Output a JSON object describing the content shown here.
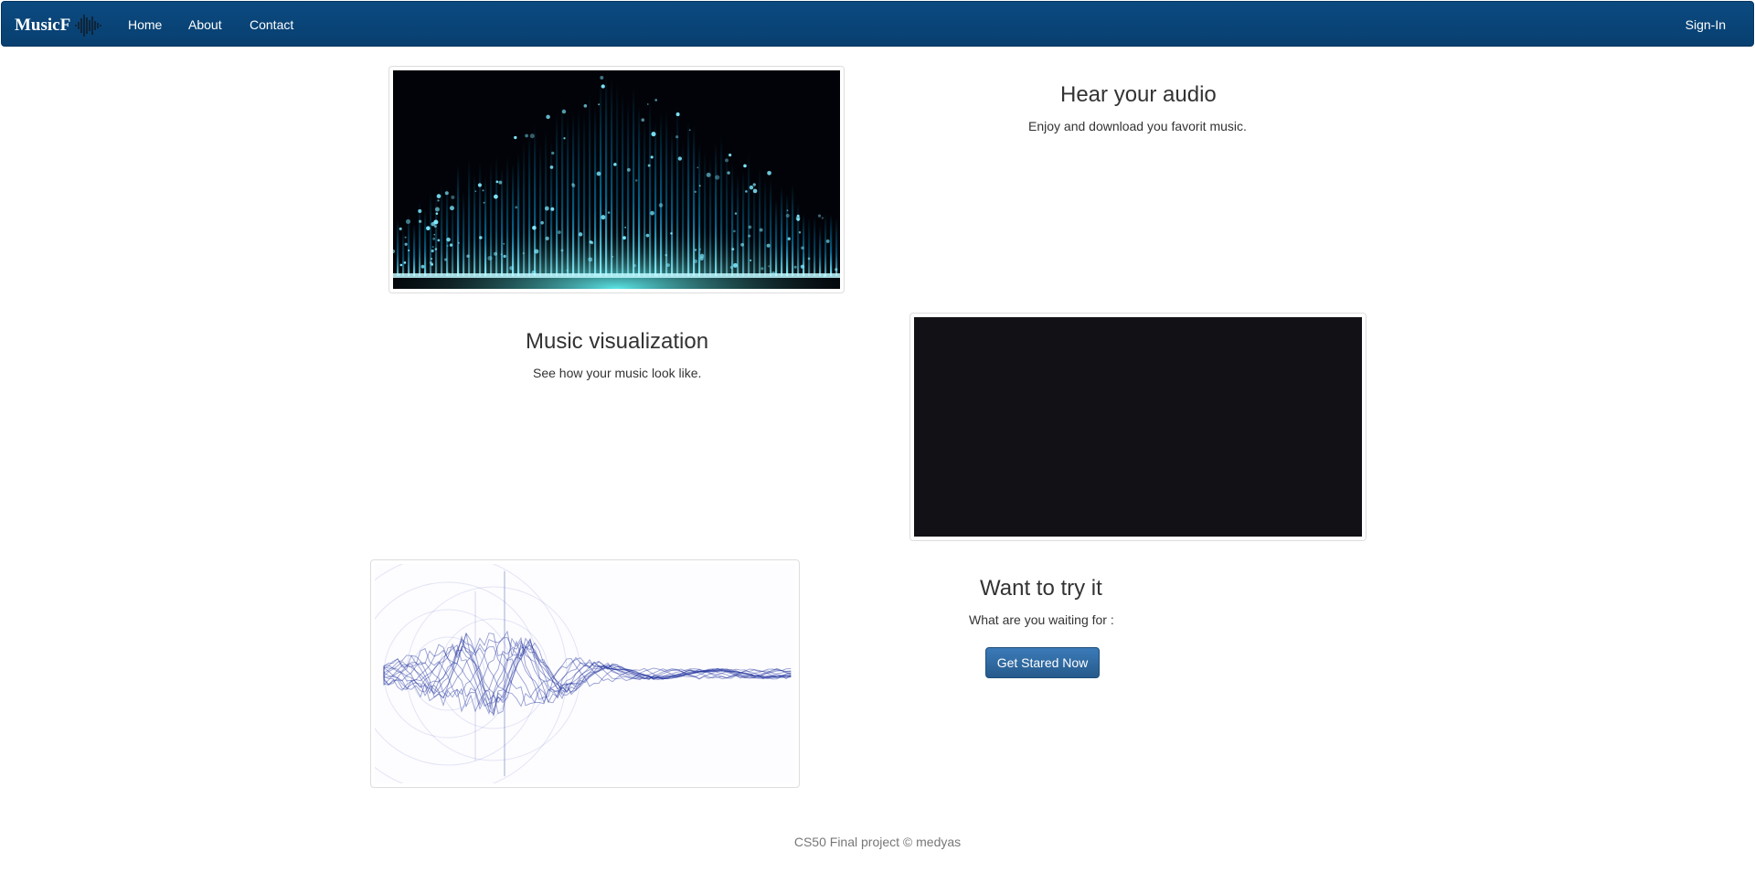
{
  "navbar": {
    "brand": "MusicF",
    "links": [
      "Home",
      "About",
      "Contact"
    ],
    "signin": "Sign-In"
  },
  "features": [
    {
      "title": "Hear your audio",
      "text": "Enjoy and download you favorit music."
    },
    {
      "title": "Music visualization",
      "text": "See how your music look like."
    },
    {
      "title": "Want to try it",
      "text": "What are you waiting for :"
    }
  ],
  "cta": {
    "label": "Get Stared Now"
  },
  "footer": {
    "text": "CS50 Final project © medyas"
  },
  "colors": {
    "navbar": "#0b4a80",
    "button": "#2f6ea8"
  }
}
